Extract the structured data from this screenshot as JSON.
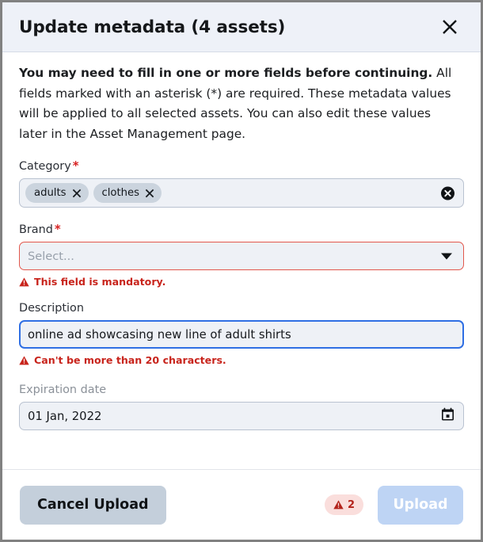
{
  "dialog": {
    "title": "Update metadata (4 assets)",
    "close_icon": "close-icon",
    "intro_bold": "You may need to fill in one or more fields before continuing.",
    "intro_rest": " All fields marked with an asterisk (*) are required. These metadata values will be applied to all selected assets. You can also edit these values later in the Asset Management page."
  },
  "fields": {
    "category": {
      "label": "Category",
      "required_marker": "*",
      "tags": [
        {
          "label": "adults",
          "remove_icon": "close-icon"
        },
        {
          "label": "clothes",
          "remove_icon": "close-icon"
        }
      ],
      "clear_icon": "clear-circle-icon"
    },
    "brand": {
      "label": "Brand",
      "required_marker": "*",
      "placeholder": "Select...",
      "value": "Select...",
      "arrow_icon": "chevron-down-icon",
      "error": "This field is mandatory.",
      "error_icon": "warning-triangle-icon"
    },
    "description": {
      "label": "Description",
      "value": "online ad showcasing new line of adult shirts",
      "error": "Can't be more than 20 characters.",
      "error_icon": "warning-triangle-icon"
    },
    "expiration_date": {
      "label": "Expiration date",
      "value": "01 Jan, 2022",
      "calendar_icon": "calendar-icon"
    }
  },
  "footer": {
    "cancel_label": "Cancel Upload",
    "error_count": "2",
    "error_badge_icon": "warning-triangle-icon",
    "upload_label": "Upload"
  },
  "colors": {
    "error_red": "#c8241c",
    "required_star": "#d72020",
    "focus_blue": "#2f6fe4",
    "header_bg": "#eef1f8",
    "upload_disabled": "#bed4f4",
    "cancel_bg": "#c4cfdb"
  }
}
